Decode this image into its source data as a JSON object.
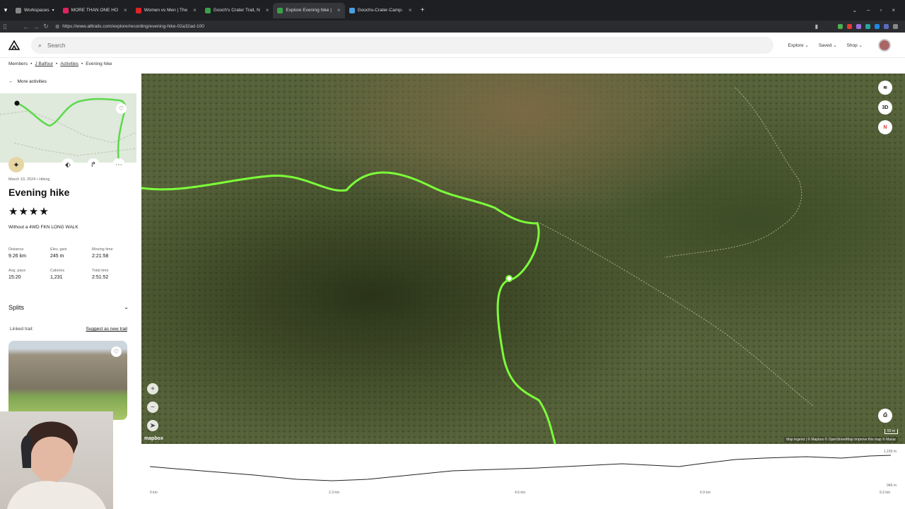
{
  "browser": {
    "workspace_label": "Workspaces",
    "tabs": [
      {
        "label": "MORE THAN ONE HO",
        "color": "#e0245e"
      },
      {
        "label": "Women vs Men | The",
        "color": "#e02424"
      },
      {
        "label": "Gooch's Crater Trail, N",
        "color": "#3aa14a"
      },
      {
        "label": "Explore Evening hike |",
        "color": "#3aa14a"
      },
      {
        "label": "Goochs-Crater-Camp-",
        "color": "#4a9ee0"
      }
    ],
    "url": "https://www.alltrails.com/explore/recording/evening-hike-02a32ad-100"
  },
  "header": {
    "search_placeholder": "Search",
    "nav": [
      "Explore",
      "Saved",
      "Shop"
    ]
  },
  "breadcrumb": {
    "items": [
      "Members",
      "J Balfour",
      "Activities",
      "Evening hike"
    ]
  },
  "sidebar": {
    "back_label": "More activities",
    "date_line": "March 10, 2024 • Hiking",
    "title": "Evening hike",
    "rating": 4,
    "description": "Without a 4WD FKN LONG WALK",
    "stats": [
      {
        "label": "Distance",
        "value": "9.26 km"
      },
      {
        "label": "Elev. gain",
        "value": "245 m"
      },
      {
        "label": "Moving time",
        "value": "2:21:58"
      },
      {
        "label": "Avg. pace",
        "value": "15:20"
      },
      {
        "label": "Calories",
        "value": "1,231"
      },
      {
        "label": "Total time",
        "value": "2:51:52"
      }
    ],
    "splits_label": "Splits",
    "linked_trail_label": "Linked trail:",
    "suggest_label": "Suggest as new trail"
  },
  "map": {
    "layers_icon": "layers-icon",
    "btn_3d": "3D",
    "btn_north": "N",
    "mapbox_label": "mapbox",
    "attribution": "Map legend | © Mapbox © OpenStreetMap Improve this map © Maxar",
    "route_color": "#7cff3a",
    "scale_label": "50 m"
  },
  "elevation": {
    "x_ticks": [
      "0 km",
      "2.3 km",
      "4.6 km",
      "6.9 km",
      "9.3 km"
    ],
    "y_max": "1,159 m",
    "y_min": "946 m"
  }
}
